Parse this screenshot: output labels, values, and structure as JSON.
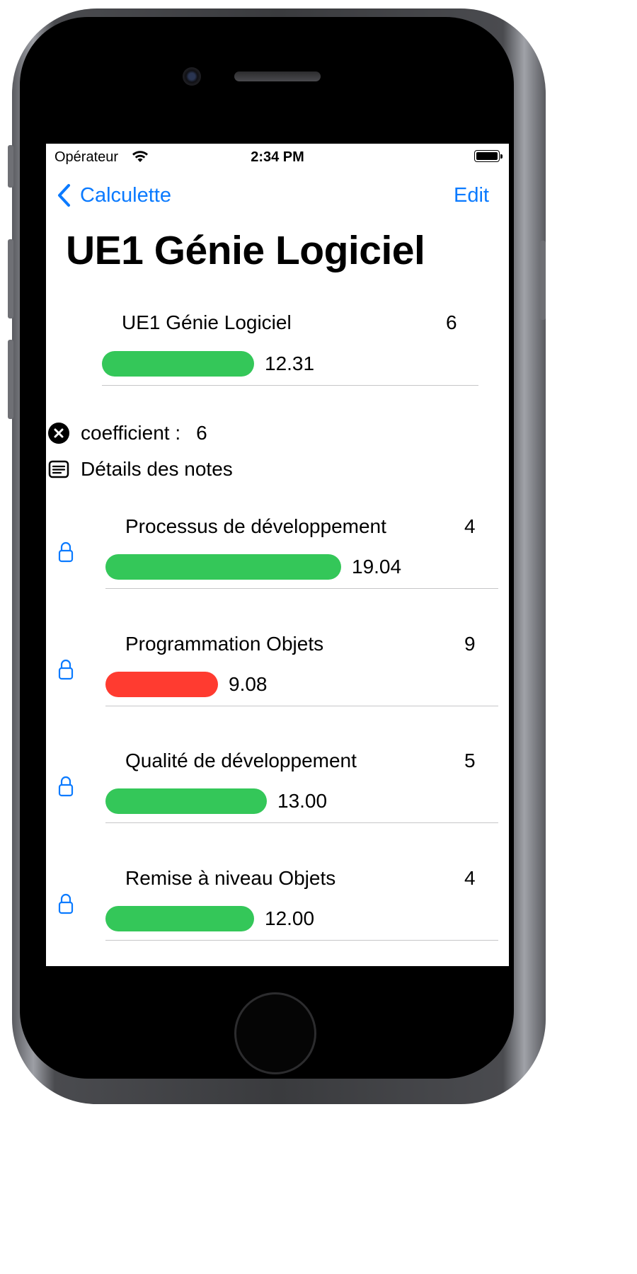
{
  "status_bar": {
    "carrier": "Opérateur",
    "time": "2:34 PM"
  },
  "nav": {
    "back_label": "Calculette",
    "edit_label": "Edit"
  },
  "page_title": "UE1 Génie Logiciel",
  "summary": {
    "name": "UE1 Génie Logiciel",
    "coefficient": "6",
    "average": "12.31",
    "fill_fraction": 0.6155,
    "color": "#34c759"
  },
  "details": {
    "coefficient_label": "coefficient :",
    "coefficient_value": "6",
    "notes_label": "Détails des notes"
  },
  "colors": {
    "accent": "#0a7aff",
    "pass": "#34c759",
    "fail": "#ff3b30"
  },
  "subjects": [
    {
      "name": "Processus de développement",
      "coefficient": "4",
      "average": "19.04",
      "fill_fraction": 0.952,
      "color": "#34c759"
    },
    {
      "name": "Programmation Objets",
      "coefficient": "9",
      "average": "9.08",
      "fill_fraction": 0.454,
      "color": "#ff3b30"
    },
    {
      "name": "Qualité de développement",
      "coefficient": "5",
      "average": "13.00",
      "fill_fraction": 0.65,
      "color": "#34c759"
    },
    {
      "name": "Remise à niveau Objets",
      "coefficient": "4",
      "average": "12.00",
      "fill_fraction": 0.6,
      "color": "#34c759"
    }
  ]
}
